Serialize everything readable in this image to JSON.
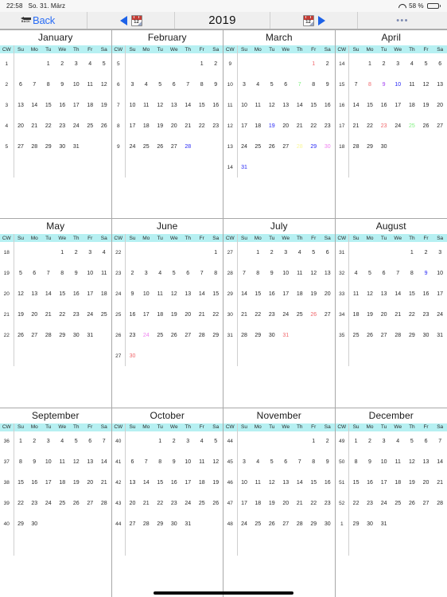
{
  "status_bar": {
    "time": "22:58",
    "date": "So. 31. März",
    "wifi_icon": "wifi-icon",
    "battery_percent": "58 %",
    "battery_level": 58
  },
  "toolbar": {
    "back_glyph_label": "BACK",
    "back_label": "Back",
    "prev_icon": "calendar-icon",
    "prev_arrow_icon": "triangle-left-icon",
    "prev_icon_number": "12",
    "year": "2019",
    "next_icon": "calendar-icon",
    "next_arrow_icon": "triangle-right-icon",
    "next_icon_number": "12",
    "more_label": "•••"
  },
  "colors": {
    "header_row": "#b6f0f2",
    "accent_blue": "#2a6df5",
    "red": "#f0666b",
    "green": "#7ff07f",
    "blue": "#2727f5",
    "purple": "#a13ef0",
    "magenta": "#f07ff0",
    "yellow": "#f9f79a",
    "text": "#262626",
    "grid_line": "#a8a8a8"
  },
  "weekday_headers": [
    "CW",
    "Su",
    "Mo",
    "Tu",
    "We",
    "Th",
    "Fr",
    "Sa"
  ],
  "months": [
    {
      "name": "January",
      "weeks": [
        {
          "cw": "1",
          "days": [
            "",
            "",
            "1",
            "2",
            "3",
            "4",
            "5"
          ]
        },
        {
          "cw": "2",
          "days": [
            "6",
            "7",
            "8",
            "9",
            "10",
            "11",
            "12"
          ]
        },
        {
          "cw": "3",
          "days": [
            "13",
            "14",
            "15",
            "16",
            "17",
            "18",
            "19"
          ]
        },
        {
          "cw": "4",
          "days": [
            "20",
            "21",
            "22",
            "23",
            "24",
            "25",
            "26"
          ]
        },
        {
          "cw": "5",
          "days": [
            "27",
            "28",
            "29",
            "30",
            "31",
            "",
            ""
          ]
        },
        {
          "cw": "",
          "days": [
            "",
            "",
            "",
            "",
            "",
            "",
            ""
          ]
        }
      ],
      "highlights": {}
    },
    {
      "name": "February",
      "weeks": [
        {
          "cw": "5",
          "days": [
            "",
            "",
            "",
            "",
            "",
            "1",
            "2"
          ]
        },
        {
          "cw": "6",
          "days": [
            "3",
            "4",
            "5",
            "6",
            "7",
            "8",
            "9"
          ]
        },
        {
          "cw": "7",
          "days": [
            "10",
            "11",
            "12",
            "13",
            "14",
            "15",
            "16"
          ]
        },
        {
          "cw": "8",
          "days": [
            "17",
            "18",
            "19",
            "20",
            "21",
            "22",
            "23"
          ]
        },
        {
          "cw": "9",
          "days": [
            "24",
            "25",
            "26",
            "27",
            "28",
            "",
            ""
          ]
        },
        {
          "cw": "",
          "days": [
            "",
            "",
            "",
            "",
            "",
            "",
            ""
          ]
        }
      ],
      "highlights": {
        "28": "blue"
      }
    },
    {
      "name": "March",
      "weeks": [
        {
          "cw": "9",
          "days": [
            "",
            "",
            "",
            "",
            "",
            "1",
            "2"
          ]
        },
        {
          "cw": "10",
          "days": [
            "3",
            "4",
            "5",
            "6",
            "7",
            "8",
            "9"
          ]
        },
        {
          "cw": "11",
          "days": [
            "10",
            "11",
            "12",
            "13",
            "14",
            "15",
            "16"
          ]
        },
        {
          "cw": "12",
          "days": [
            "17",
            "18",
            "19",
            "20",
            "21",
            "22",
            "23"
          ]
        },
        {
          "cw": "13",
          "days": [
            "24",
            "25",
            "26",
            "27",
            "28",
            "29",
            "30"
          ]
        },
        {
          "cw": "14",
          "days": [
            "31",
            "",
            "",
            "",
            "",
            "",
            ""
          ]
        }
      ],
      "highlights": {
        "1": "red",
        "7": "green",
        "19": "blue",
        "28": "yellow",
        "29": "blue",
        "30": "magenta",
        "31": "blue"
      }
    },
    {
      "name": "April",
      "weeks": [
        {
          "cw": "14",
          "days": [
            "",
            "1",
            "2",
            "3",
            "4",
            "5",
            "6"
          ]
        },
        {
          "cw": "15",
          "days": [
            "7",
            "8",
            "9",
            "10",
            "11",
            "12",
            "13"
          ]
        },
        {
          "cw": "16",
          "days": [
            "14",
            "15",
            "16",
            "17",
            "18",
            "19",
            "20"
          ]
        },
        {
          "cw": "17",
          "days": [
            "21",
            "22",
            "23",
            "24",
            "25",
            "26",
            "27"
          ]
        },
        {
          "cw": "18",
          "days": [
            "28",
            "29",
            "30",
            "",
            "",
            "",
            ""
          ]
        },
        {
          "cw": "",
          "days": [
            "",
            "",
            "",
            "",
            "",
            "",
            ""
          ]
        }
      ],
      "highlights": {
        "8": "red",
        "9": "purple",
        "10": "blue",
        "23": "red",
        "25": "green"
      }
    },
    {
      "name": "May",
      "weeks": [
        {
          "cw": "18",
          "days": [
            "",
            "",
            "",
            "1",
            "2",
            "3",
            "4"
          ]
        },
        {
          "cw": "19",
          "days": [
            "5",
            "6",
            "7",
            "8",
            "9",
            "10",
            "11"
          ]
        },
        {
          "cw": "20",
          "days": [
            "12",
            "13",
            "14",
            "15",
            "16",
            "17",
            "18"
          ]
        },
        {
          "cw": "21",
          "days": [
            "19",
            "20",
            "21",
            "22",
            "23",
            "24",
            "25"
          ]
        },
        {
          "cw": "22",
          "days": [
            "26",
            "27",
            "28",
            "29",
            "30",
            "31",
            ""
          ]
        },
        {
          "cw": "",
          "days": [
            "",
            "",
            "",
            "",
            "",
            "",
            ""
          ]
        }
      ],
      "highlights": {}
    },
    {
      "name": "June",
      "weeks": [
        {
          "cw": "22",
          "days": [
            "",
            "",
            "",
            "",
            "",
            "",
            "1"
          ]
        },
        {
          "cw": "23",
          "days": [
            "2",
            "3",
            "4",
            "5",
            "6",
            "7",
            "8"
          ]
        },
        {
          "cw": "24",
          "days": [
            "9",
            "10",
            "11",
            "12",
            "13",
            "14",
            "15"
          ]
        },
        {
          "cw": "25",
          "days": [
            "16",
            "17",
            "18",
            "19",
            "20",
            "21",
            "22"
          ]
        },
        {
          "cw": "26",
          "days": [
            "23",
            "24",
            "25",
            "26",
            "27",
            "28",
            "29"
          ]
        },
        {
          "cw": "27",
          "days": [
            "30",
            "",
            "",
            "",
            "",
            "",
            ""
          ]
        }
      ],
      "highlights": {
        "24": "magenta",
        "30": "red"
      }
    },
    {
      "name": "July",
      "weeks": [
        {
          "cw": "27",
          "days": [
            "",
            "1",
            "2",
            "3",
            "4",
            "5",
            "6"
          ]
        },
        {
          "cw": "28",
          "days": [
            "7",
            "8",
            "9",
            "10",
            "11",
            "12",
            "13"
          ]
        },
        {
          "cw": "29",
          "days": [
            "14",
            "15",
            "16",
            "17",
            "18",
            "19",
            "20"
          ]
        },
        {
          "cw": "30",
          "days": [
            "21",
            "22",
            "23",
            "24",
            "25",
            "26",
            "27"
          ]
        },
        {
          "cw": "31",
          "days": [
            "28",
            "29",
            "30",
            "31",
            "",
            "",
            ""
          ]
        },
        {
          "cw": "",
          "days": [
            "",
            "",
            "",
            "",
            "",
            "",
            ""
          ]
        }
      ],
      "highlights": {
        "26": "red",
        "31": "red"
      }
    },
    {
      "name": "August",
      "weeks": [
        {
          "cw": "31",
          "days": [
            "",
            "",
            "",
            "",
            "1",
            "2",
            "3"
          ]
        },
        {
          "cw": "32",
          "days": [
            "4",
            "5",
            "6",
            "7",
            "8",
            "9",
            "10"
          ]
        },
        {
          "cw": "33",
          "days": [
            "11",
            "12",
            "13",
            "14",
            "15",
            "16",
            "17"
          ]
        },
        {
          "cw": "34",
          "days": [
            "18",
            "19",
            "20",
            "21",
            "22",
            "23",
            "24"
          ]
        },
        {
          "cw": "35",
          "days": [
            "25",
            "26",
            "27",
            "28",
            "29",
            "30",
            "31"
          ]
        },
        {
          "cw": "",
          "days": [
            "",
            "",
            "",
            "",
            "",
            "",
            ""
          ]
        }
      ],
      "highlights": {
        "9": "blue"
      }
    },
    {
      "name": "September",
      "weeks": [
        {
          "cw": "36",
          "days": [
            "1",
            "2",
            "3",
            "4",
            "5",
            "6",
            "7"
          ]
        },
        {
          "cw": "37",
          "days": [
            "8",
            "9",
            "10",
            "11",
            "12",
            "13",
            "14"
          ]
        },
        {
          "cw": "38",
          "days": [
            "15",
            "16",
            "17",
            "18",
            "19",
            "20",
            "21"
          ]
        },
        {
          "cw": "39",
          "days": [
            "22",
            "23",
            "24",
            "25",
            "26",
            "27",
            "28"
          ]
        },
        {
          "cw": "40",
          "days": [
            "29",
            "30",
            "",
            "",
            "",
            "",
            ""
          ]
        },
        {
          "cw": "",
          "days": [
            "",
            "",
            "",
            "",
            "",
            "",
            ""
          ]
        }
      ],
      "highlights": {}
    },
    {
      "name": "October",
      "weeks": [
        {
          "cw": "40",
          "days": [
            "",
            "",
            "1",
            "2",
            "3",
            "4",
            "5"
          ]
        },
        {
          "cw": "41",
          "days": [
            "6",
            "7",
            "8",
            "9",
            "10",
            "11",
            "12"
          ]
        },
        {
          "cw": "42",
          "days": [
            "13",
            "14",
            "15",
            "16",
            "17",
            "18",
            "19"
          ]
        },
        {
          "cw": "43",
          "days": [
            "20",
            "21",
            "22",
            "23",
            "24",
            "25",
            "26"
          ]
        },
        {
          "cw": "44",
          "days": [
            "27",
            "28",
            "29",
            "30",
            "31",
            "",
            ""
          ]
        },
        {
          "cw": "",
          "days": [
            "",
            "",
            "",
            "",
            "",
            "",
            ""
          ]
        }
      ],
      "highlights": {}
    },
    {
      "name": "November",
      "weeks": [
        {
          "cw": "44",
          "days": [
            "",
            "",
            "",
            "",
            "",
            "1",
            "2"
          ]
        },
        {
          "cw": "45",
          "days": [
            "3",
            "4",
            "5",
            "6",
            "7",
            "8",
            "9"
          ]
        },
        {
          "cw": "46",
          "days": [
            "10",
            "11",
            "12",
            "13",
            "14",
            "15",
            "16"
          ]
        },
        {
          "cw": "47",
          "days": [
            "17",
            "18",
            "19",
            "20",
            "21",
            "22",
            "23"
          ]
        },
        {
          "cw": "48",
          "days": [
            "24",
            "25",
            "26",
            "27",
            "28",
            "29",
            "30"
          ]
        },
        {
          "cw": "",
          "days": [
            "",
            "",
            "",
            "",
            "",
            "",
            ""
          ]
        }
      ],
      "highlights": {}
    },
    {
      "name": "December",
      "weeks": [
        {
          "cw": "49",
          "days": [
            "1",
            "2",
            "3",
            "4",
            "5",
            "6",
            "7"
          ]
        },
        {
          "cw": "50",
          "days": [
            "8",
            "9",
            "10",
            "11",
            "12",
            "13",
            "14"
          ]
        },
        {
          "cw": "51",
          "days": [
            "15",
            "16",
            "17",
            "18",
            "19",
            "20",
            "21"
          ]
        },
        {
          "cw": "52",
          "days": [
            "22",
            "23",
            "24",
            "25",
            "26",
            "27",
            "28"
          ]
        },
        {
          "cw": "1",
          "days": [
            "29",
            "30",
            "31",
            "",
            "",
            "",
            ""
          ]
        },
        {
          "cw": "",
          "days": [
            "",
            "",
            "",
            "",
            "",
            "",
            ""
          ]
        }
      ],
      "highlights": {}
    }
  ]
}
